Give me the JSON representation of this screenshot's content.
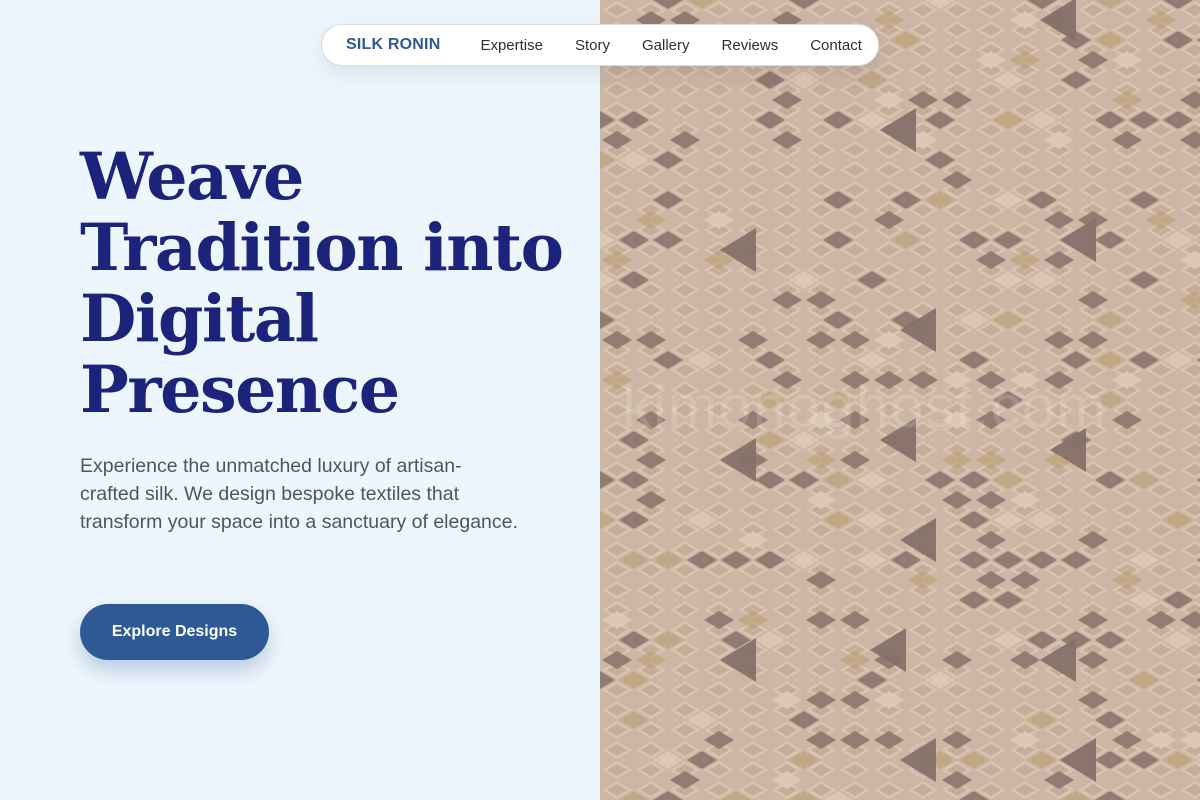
{
  "nav": {
    "brand": "SILK RONIN",
    "links": [
      "Expertise",
      "Story",
      "Gallery",
      "Reviews",
      "Contact"
    ]
  },
  "hero": {
    "title": "Weave Tradition into Digital Presence",
    "subtitle": "Experience the unmatched luxury of artisan-crafted silk. We design bespoke textiles that transform your space into a sanctuary of elegance.",
    "cta_label": "Explore Designs"
  },
  "image": {
    "description": "silk-textile-pattern",
    "watermark": "kimonoghost.com"
  },
  "colors": {
    "background": "#eef6fd",
    "title": "#1b237a",
    "brand": "#2d5a94",
    "button": "#2d5a94",
    "body_text": "#4c5566",
    "fabric_base": "#cdb6a3",
    "fabric_light": "#ddc9b6",
    "fabric_dark": "#86716a",
    "fabric_gold": "#b99a6e"
  }
}
